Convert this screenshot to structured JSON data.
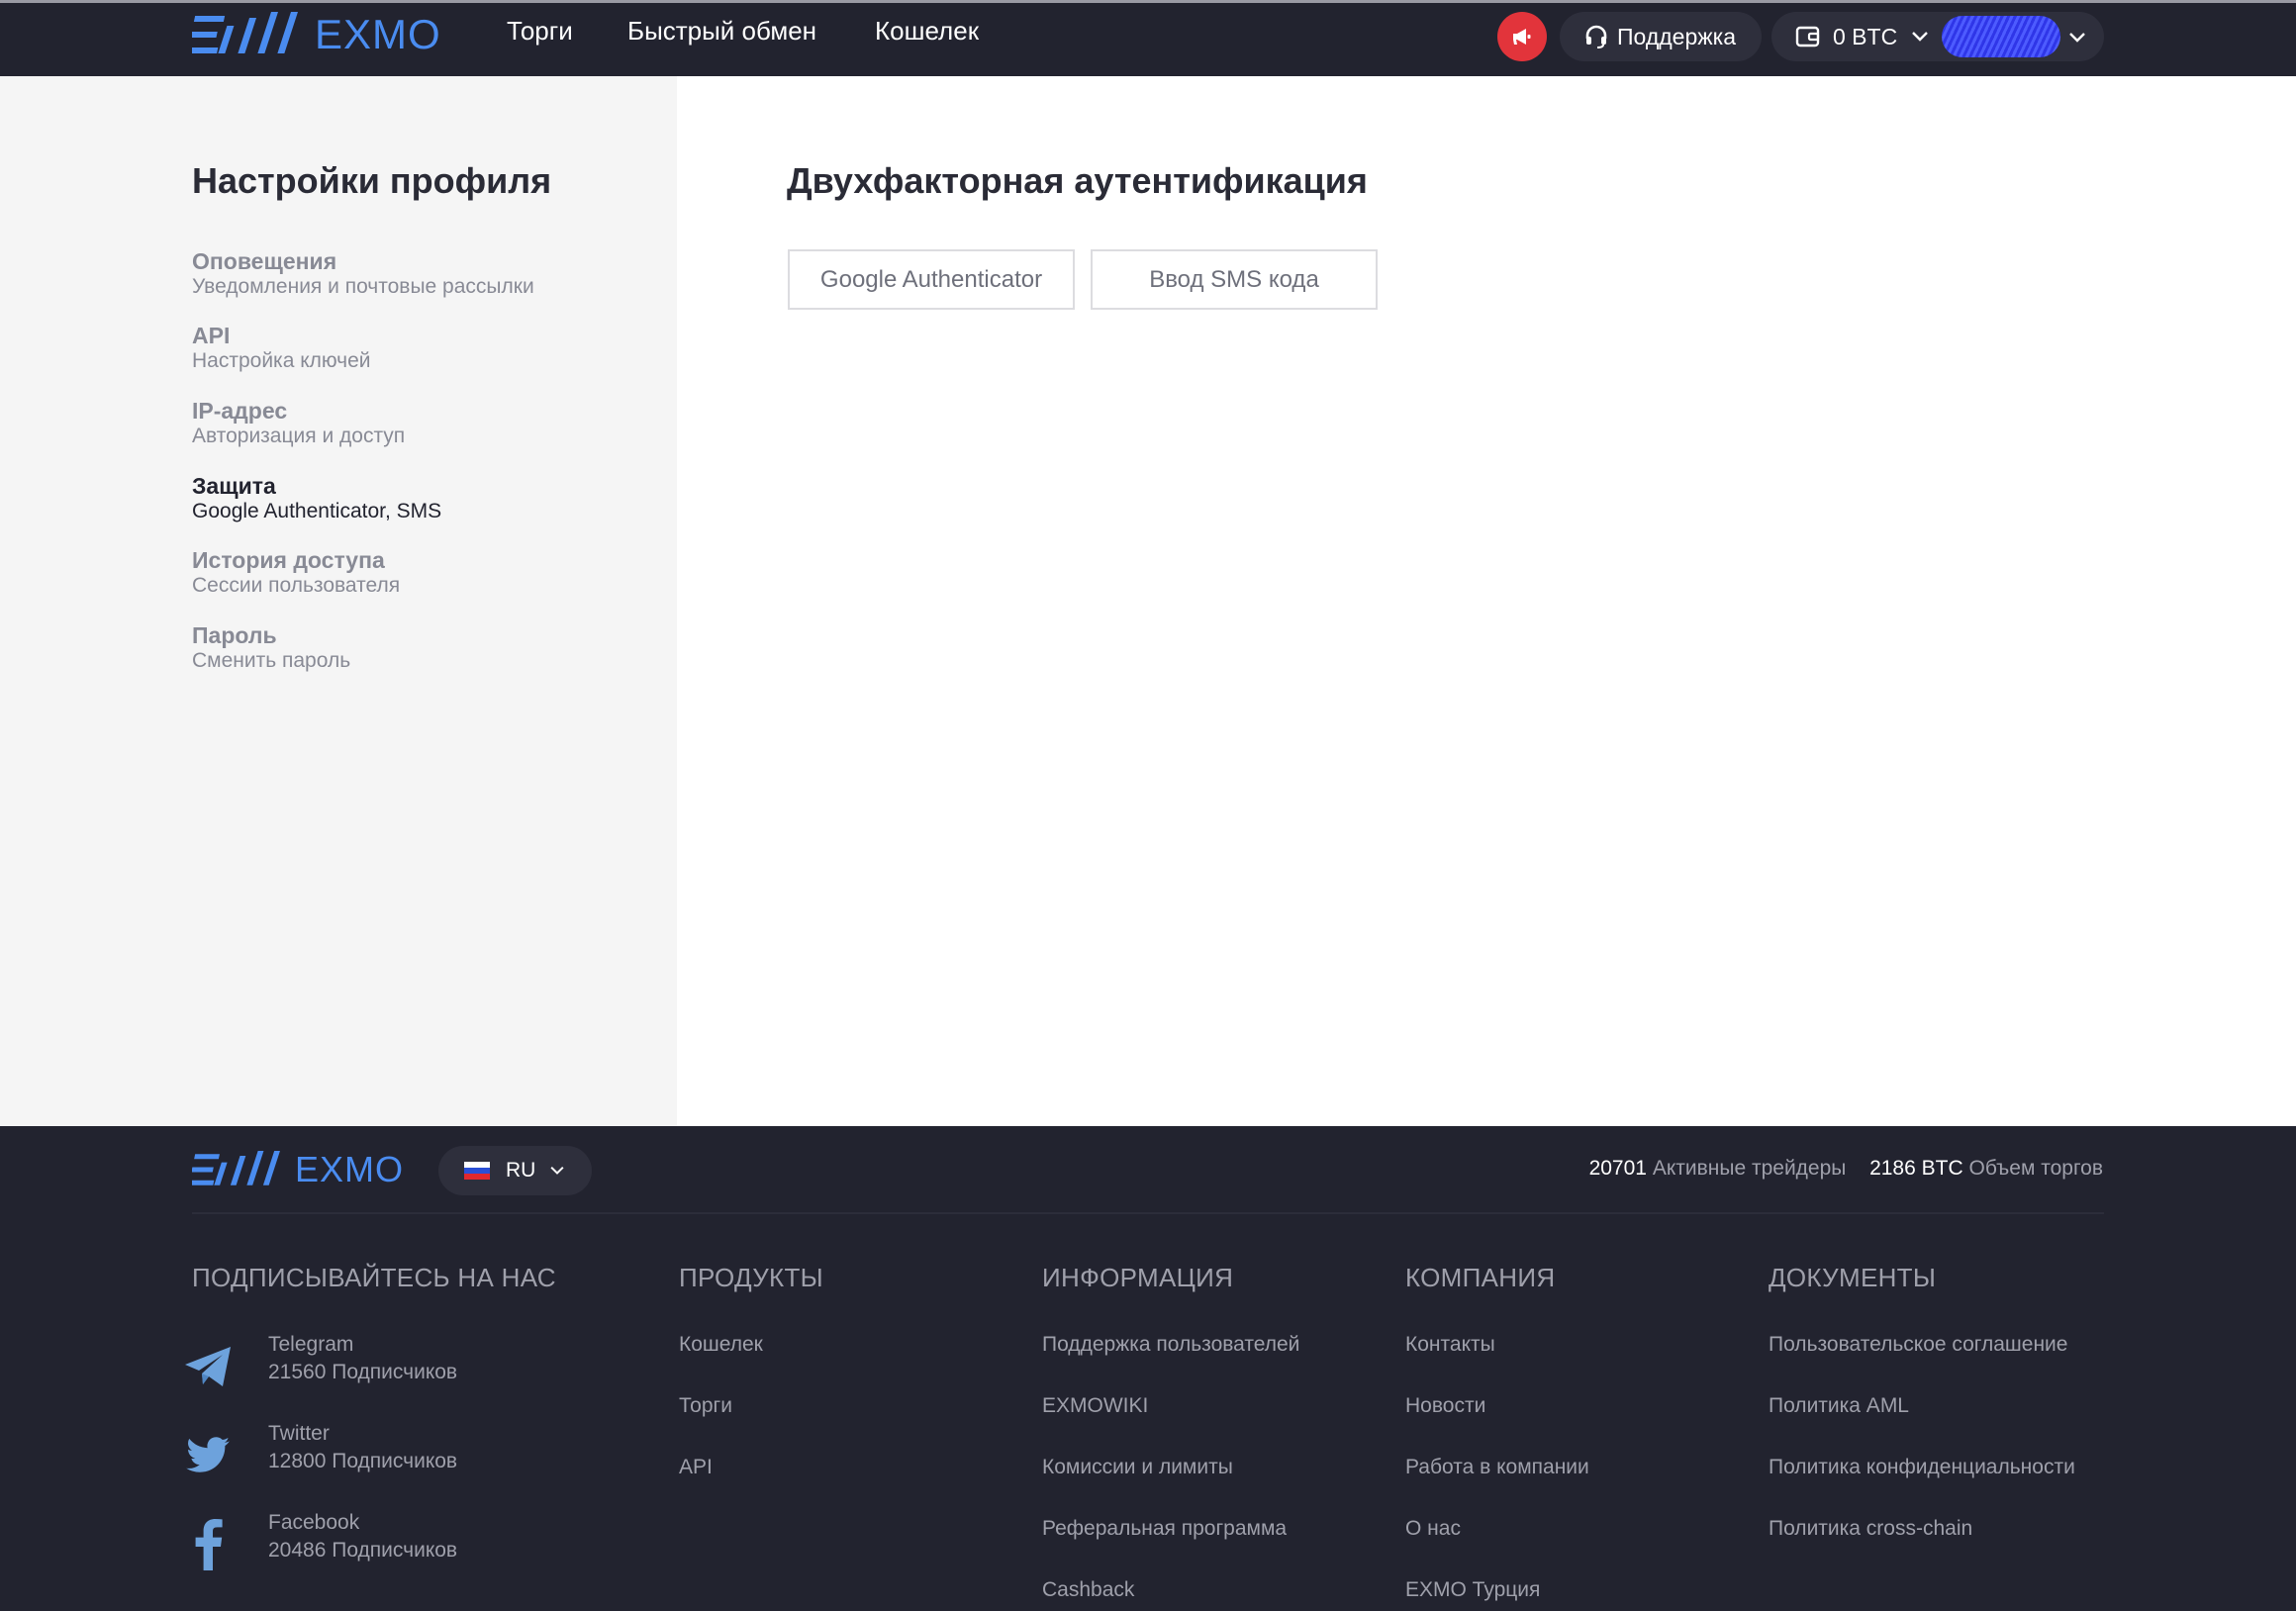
{
  "header": {
    "brand": "EXMO",
    "nav": [
      "Торги",
      "Быстрый обмен",
      "Кошелек"
    ],
    "support_label": "Поддержка",
    "balance_label": "0 BTC"
  },
  "sidebar": {
    "title": "Настройки профиля",
    "items": [
      {
        "title": "Оповещения",
        "subtitle": "Уведомления и почтовые рассылки"
      },
      {
        "title": "API",
        "subtitle": "Настройка ключей"
      },
      {
        "title": "IP-адрес",
        "subtitle": "Авторизация и доступ"
      },
      {
        "title": "Защита",
        "subtitle": "Google Authenticator, SMS"
      },
      {
        "title": "История доступа",
        "subtitle": "Сессии пользователя"
      },
      {
        "title": "Пароль",
        "subtitle": "Сменить пароль"
      }
    ],
    "active_item": "Защита"
  },
  "main": {
    "title": "Двухфакторная аутентификация",
    "tabs": [
      "Google Authenticator",
      "Ввод SMS кода"
    ]
  },
  "footer": {
    "brand": "EXMO",
    "language": "RU",
    "stats": {
      "traders_value": "20701",
      "traders_label": "Активные трейдеры",
      "volume_value": "2186 BTC",
      "volume_label": "Объем торгов"
    },
    "columns": {
      "social": {
        "heading": "ПОДПИСЫВАЙТЕСЬ НА НАС",
        "items": [
          {
            "name": "Telegram",
            "count": "21560 Подписчиков",
            "icon": "telegram-icon"
          },
          {
            "name": "Twitter",
            "count": "12800 Подписчиков",
            "icon": "twitter-icon"
          },
          {
            "name": "Facebook",
            "count": "20486 Подписчиков",
            "icon": "facebook-icon"
          }
        ]
      },
      "products": {
        "heading": "ПРОДУКТЫ",
        "links": [
          "Кошелек",
          "Торги",
          "API"
        ]
      },
      "info": {
        "heading": "ИНФОРМАЦИЯ",
        "links": [
          "Поддержка пользователей",
          "EXMOWIKI",
          "Комиссии и лимиты",
          "Реферальная программа",
          "Cashback"
        ]
      },
      "company": {
        "heading": "КОМПАНИЯ",
        "links": [
          "Контакты",
          "Новости",
          "Работа в компании",
          "О нас",
          "EXMO Турция"
        ]
      },
      "docs": {
        "heading": "ДОКУМЕНТЫ",
        "links": [
          "Пользовательское соглашение",
          "Политика AML",
          "Политика конфиденциальности",
          "Политика cross-chain"
        ]
      }
    }
  },
  "colors": {
    "header_bg": "#22232f",
    "brand_blue": "#4a8cf0",
    "promo_red": "#e2343b",
    "sidebar_bg": "#f5f5f5"
  }
}
